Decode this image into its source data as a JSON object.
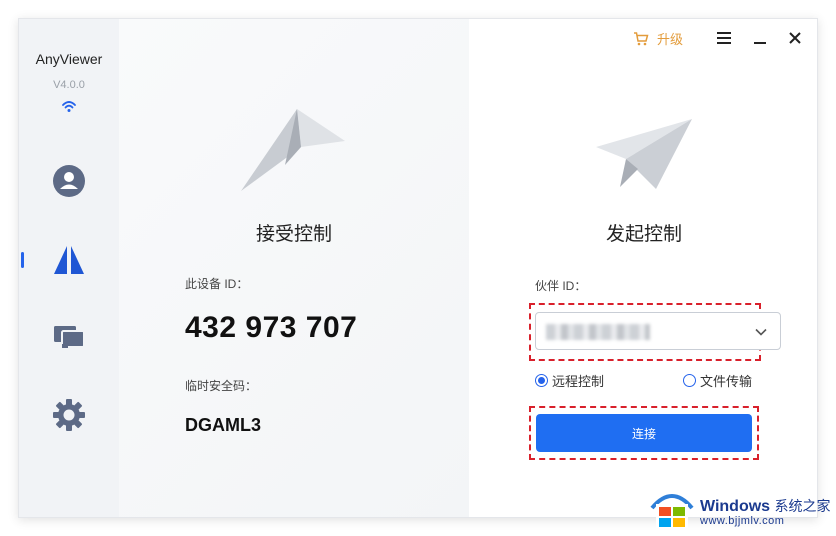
{
  "app": {
    "name": "AnyViewer",
    "version": "V4.0.0"
  },
  "topbar": {
    "upgrade_label": "升级"
  },
  "sidebar": {
    "items": [
      {
        "name": "account",
        "icon": "user-icon"
      },
      {
        "name": "remote",
        "icon": "anyviewer-logo-icon",
        "active": true
      },
      {
        "name": "devices",
        "icon": "devices-icon"
      },
      {
        "name": "settings",
        "icon": "gear-icon"
      }
    ]
  },
  "receive": {
    "title": "接受控制",
    "device_id_label": "此设备 ID：",
    "device_id": "432 973 707",
    "password_label": "临时安全码：",
    "password": "DGAML3"
  },
  "initiate": {
    "title": "发起控制",
    "partner_id_label": "伙伴 ID：",
    "partner_id_value": "",
    "mode_remote_label": "远程控制",
    "mode_file_label": "文件传输",
    "selected_mode": "remote",
    "connect_label": "连接"
  },
  "watermark": {
    "brand": "Windows",
    "brand_cn": "系统之家",
    "url": "www.bjjmlv.com"
  },
  "colors": {
    "accent": "#1f6ef2",
    "upgrade": "#e39c3c",
    "highlight": "#d9202b"
  }
}
